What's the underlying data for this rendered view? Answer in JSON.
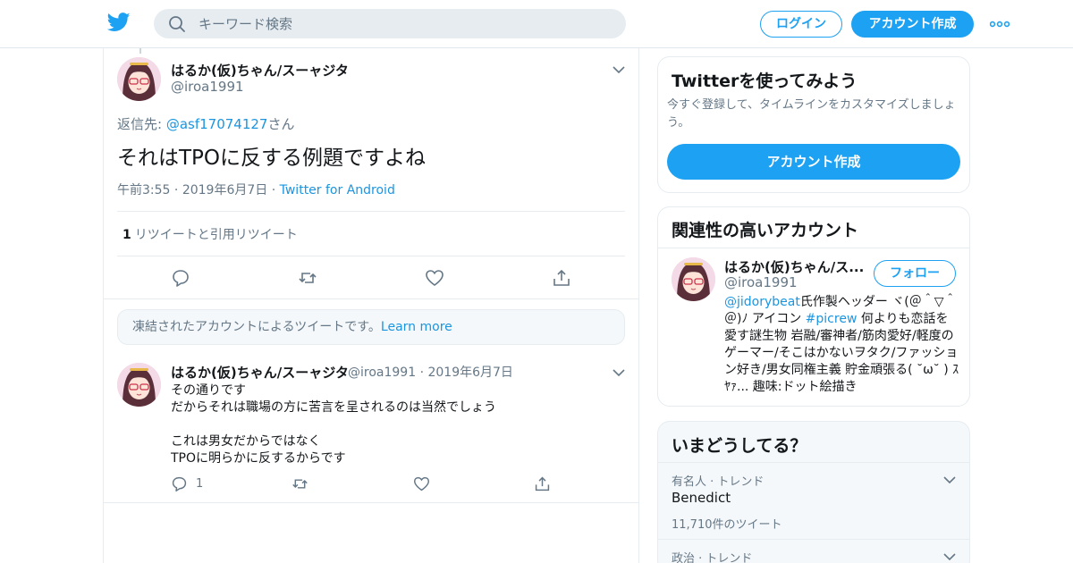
{
  "header": {
    "logo_icon": "twitter-bird-icon",
    "search_placeholder": "キーワード検索",
    "login_label": "ログイン",
    "signup_label": "アカウント作成",
    "more_icon": "more-dots-icon",
    "brand_color": "#1da1f2"
  },
  "main_tweet": {
    "display_name": "はるか(仮)ちゃん/スーャジタ",
    "handle": "@iroa1991",
    "reply_prefix": "返信先: ",
    "reply_mention": "@asf17074127",
    "reply_suffix": "さん",
    "text": "それはTPOに反する例題ですよね",
    "time": "午前3:55",
    "date": "2019年6月7日",
    "source": "Twitter for Android",
    "retweet_count": "1",
    "retweet_label": "リツイートと引用リツイート"
  },
  "notice": {
    "text": "凍結されたアカウントによるツイートです。",
    "link": "Learn more"
  },
  "reply_tweet": {
    "display_name": "はるか(仮)ちゃん/スーャジタ",
    "handle": "@iroa1991",
    "date": "2019年6月7日",
    "text": "その通りです\nだからそれは職場の方に苦言を呈されるのは当然でしょう\n\nこれは男女だからではなく\nTPOに明らかに反するからです",
    "reply_count": "1"
  },
  "signup_card": {
    "title": "Twitterを使ってみよう",
    "description": "今すぐ登録して、タイムラインをカスタマイズしましょう。",
    "button": "アカウント作成"
  },
  "related_card": {
    "title": "関連性の高いアカウント",
    "display_name": "はるか(仮)ちゃん/ス...",
    "handle": "@iroa1991",
    "follow_label": "フォロー",
    "bio_mention": "@jidorybeat",
    "bio_part1": "氏作製ヘッダー ヾ(＠＾▽＾＠)ﾉ アイコン ",
    "bio_hashtag": "#picrew",
    "bio_part2": " 何よりも恋話を愛す謎生物 岩融/審神者/筋肉愛好/軽度のゲーマー/そこはかないヲタク/ファッション好き/男女同権主義 貯金頑張る( ˘ω˘ ) ｽﾔｧ... 趣味:ドット絵描き"
  },
  "trends_card": {
    "title": "いまどうしてる？",
    "items": [
      {
        "category": "有名人 · トレンド",
        "name": "Benedict",
        "count": "11,710件のツイート"
      },
      {
        "category": "政治 · トレンド",
        "name": "",
        "count": ""
      }
    ]
  }
}
